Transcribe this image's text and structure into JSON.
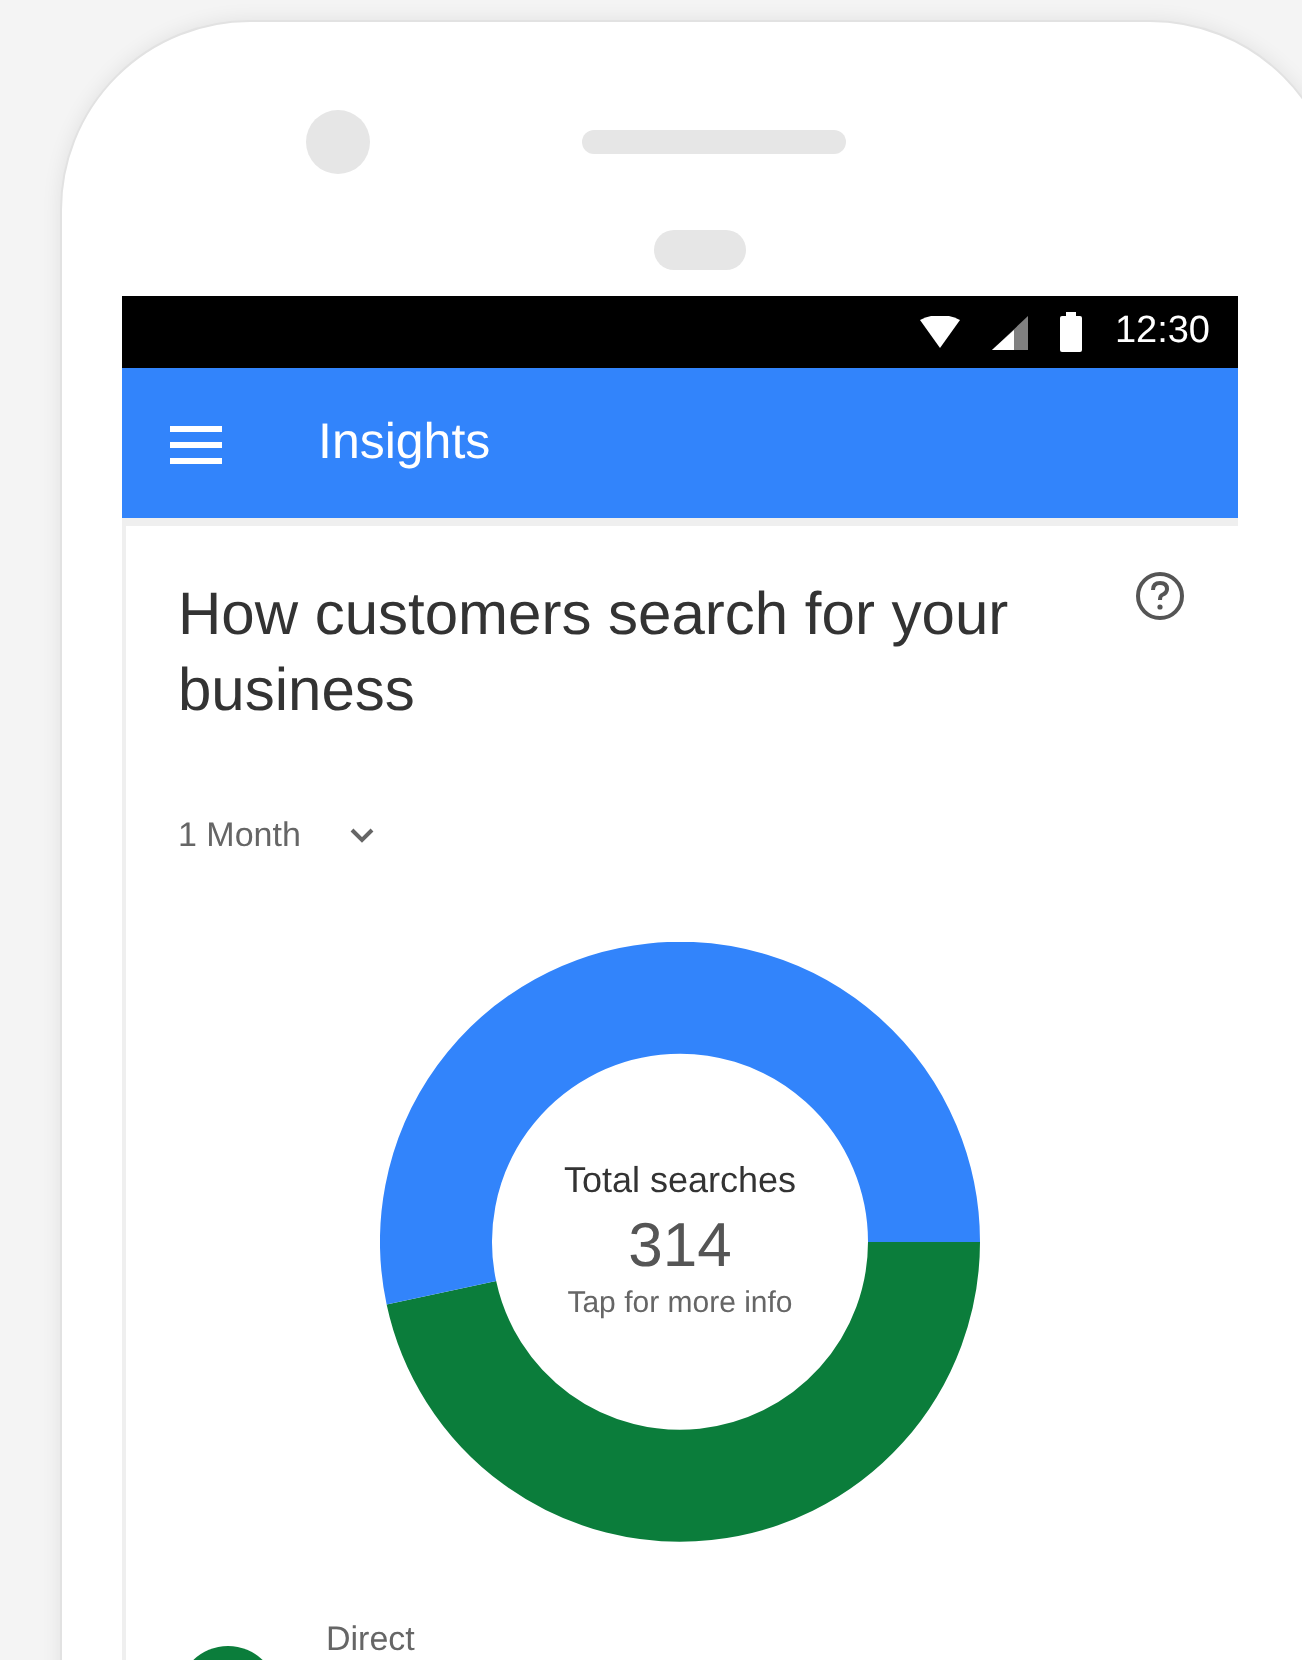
{
  "status_bar": {
    "time": "12:30"
  },
  "app_bar": {
    "title": "Insights"
  },
  "card": {
    "title": "How customers search for your business",
    "period": "1 Month",
    "donut": {
      "label": "Total searches",
      "total": "314",
      "hint": "Tap for more info"
    },
    "legend": [
      {
        "label": "Direct",
        "color": "#0b7d3b"
      }
    ]
  }
}
